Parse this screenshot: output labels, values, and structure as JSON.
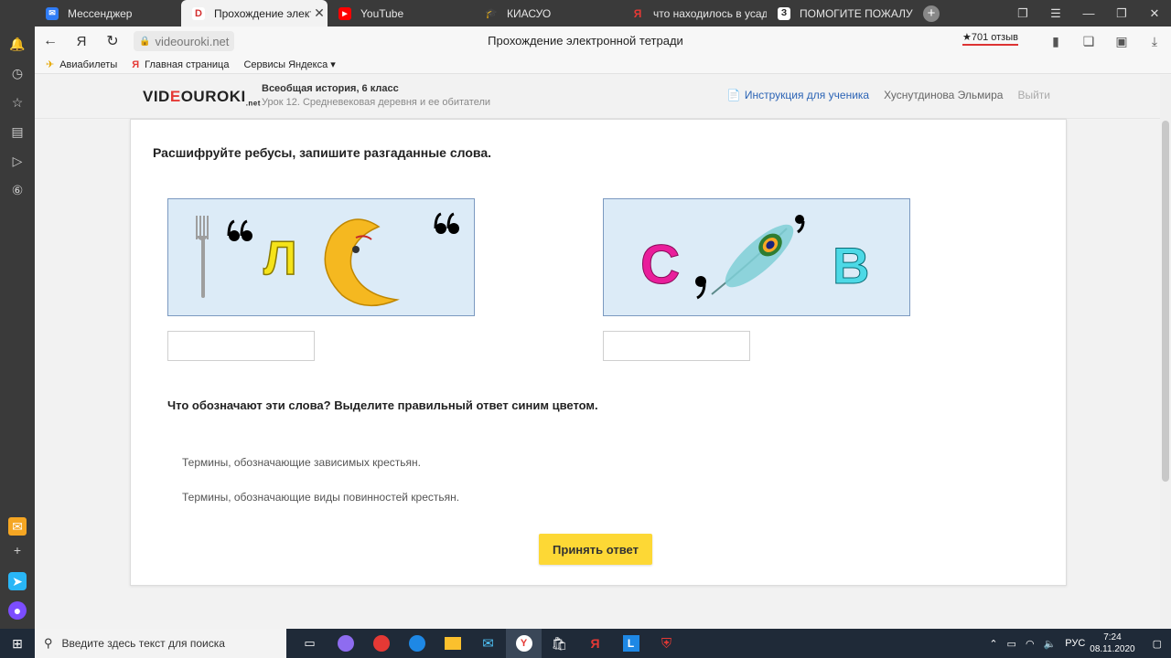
{
  "tabs": [
    {
      "title": "Мессенджер",
      "color": "#2f7cf6",
      "active": false
    },
    {
      "title": "Прохождение электро",
      "color": "#d32f2f",
      "active": true
    },
    {
      "title": "YouTube",
      "color": "#ff0000",
      "active": false
    },
    {
      "title": "КИАСУО",
      "color": "#555555",
      "active": false
    },
    {
      "title": "что находилось в усадьбе",
      "color": "#e53935",
      "active": false
    },
    {
      "title": "ПОМОГИТЕ ПОЖАЛУЙС",
      "color": "#222222",
      "active": false
    }
  ],
  "address": {
    "domain": "videouroki.net",
    "page_title": "Прохождение электронной тетради",
    "rating": "★701 отзыв"
  },
  "bookmarks": [
    {
      "label": "Авиабилеты",
      "icon": "plane-icon"
    },
    {
      "label": "Главная страница",
      "icon": "yandex-icon"
    },
    {
      "label": "Сервисы Яндекса ▾",
      "icon": ""
    }
  ],
  "site": {
    "logo_prefix": "VID",
    "logo_o": "E",
    "logo_suffix": "OUROKI",
    "logo_tld": ".net",
    "course_title": "Всеобщая история, 6 класс",
    "lesson_title": "Урок 12. Средневековая деревня и ее обитатели",
    "instruction_link": "Инструкция для ученика",
    "user_name": "Хуснутдинова Эльмира",
    "logout": "Выйти"
  },
  "task": {
    "question1": "Расшифруйте ребусы, запишите разгаданные слова.",
    "rebus1": {
      "letter": "Л"
    },
    "rebus2": {
      "letter1": "С",
      "letter2": "В"
    },
    "answer1_value": "",
    "answer2_value": "",
    "question2": "Что обозначают эти слова? Выделите правильный ответ синим цветом.",
    "options": [
      "Термины, обозначающие зависимых крестьян.",
      "Термины, обозначающие виды повинностей крестьян."
    ],
    "submit_label": "Принять ответ"
  },
  "taskbar": {
    "search_placeholder": "Введите здесь текст для поиска",
    "language": "РУС",
    "time": "7:24",
    "date": "08.11.2020"
  },
  "colors": {
    "accent_yellow": "#fdd835",
    "link_blue": "#2c64b5",
    "rebus_bg": "#dcebf7"
  }
}
